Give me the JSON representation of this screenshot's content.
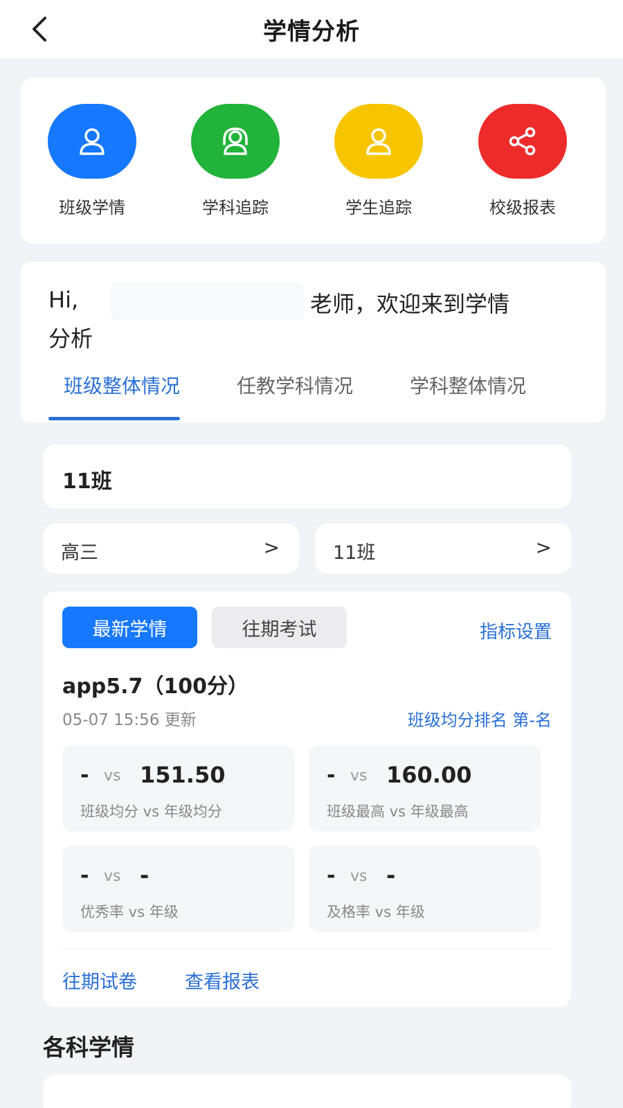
{
  "header": {
    "title": "学情分析"
  },
  "shortcuts": [
    {
      "label": "班级学情",
      "color": "#1677ff",
      "icon": "user-icon"
    },
    {
      "label": "学科追踪",
      "color": "#22b33a",
      "icon": "headset-user-icon"
    },
    {
      "label": "学生追踪",
      "color": "#f7c500",
      "icon": "user-icon"
    },
    {
      "label": "校级报表",
      "color": "#ee2b2b",
      "icon": "share-icon"
    }
  ],
  "greeting": {
    "hi": "Hi,",
    "rest": "老师，欢迎来到学情",
    "line2": "分析"
  },
  "tabs": [
    {
      "label": "班级整体情况",
      "active": true
    },
    {
      "label": "任教学科情况",
      "active": false
    },
    {
      "label": "学科整体情况",
      "active": false
    }
  ],
  "class_title": "11班",
  "selectors": [
    {
      "value": "高三",
      "arrow": ">"
    },
    {
      "value": "11班",
      "arrow": ">"
    }
  ],
  "stats": {
    "btn_latest": "最新学情",
    "btn_past": "往期考试",
    "settings_link": "指标设置",
    "exam_title": "app5.7（100分）",
    "updated": "05-07 15:56 更新",
    "rank_text": "班级均分排名 第-名",
    "metrics": [
      {
        "left": "-",
        "vs": "vs",
        "right": "151.50",
        "label": "班级均分 vs 年级均分"
      },
      {
        "left": "-",
        "vs": "vs",
        "right": "160.00",
        "label": "班级最高 vs 年级最高"
      },
      {
        "left": "-",
        "vs": "vs",
        "right": "-",
        "label": "优秀率 vs 年级"
      },
      {
        "left": "-",
        "vs": "vs",
        "right": "-",
        "label": "及格率 vs 年级"
      }
    ],
    "past_papers_link": "往期试卷",
    "view_report_link": "查看报表"
  },
  "section_title": "各科学情",
  "colors": {
    "accent": "#2a6fd6",
    "primary_button": "#1677ff",
    "background": "#f1f3f7"
  }
}
